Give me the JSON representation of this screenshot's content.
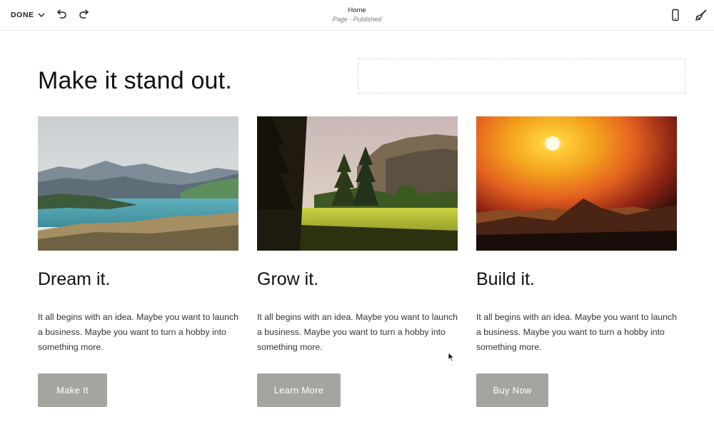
{
  "toolbar": {
    "done_label": "DONE",
    "page_title": "Home",
    "page_status": "Page · Published",
    "icons": [
      "chevron-down-icon",
      "undo-icon",
      "redo-icon",
      "mobile-view-icon",
      "paintbrush-icon"
    ]
  },
  "hero": {
    "headline": "Make it stand out."
  },
  "cards": [
    {
      "title": "Dream it.",
      "body": "It all begins with an idea. Maybe you want to launch a business. Maybe you want to turn a hobby into something more.",
      "button": "Make It",
      "image": "mountain-lake-photo"
    },
    {
      "title": "Grow it.",
      "body": "It all begins with an idea. Maybe you want to launch a business. Maybe you want to turn a hobby into something more.",
      "button": "Learn More",
      "image": "forest-meadow-photo"
    },
    {
      "title": "Build it.",
      "body": "It all begins with an idea. Maybe you want to launch a business. Maybe you want to turn a hobby into something more.",
      "button": "Buy Now",
      "image": "sunset-mountains-photo"
    }
  ],
  "colors": {
    "button_bg": "#a5a49e",
    "button_text": "#ffffff",
    "text": "#111111"
  }
}
